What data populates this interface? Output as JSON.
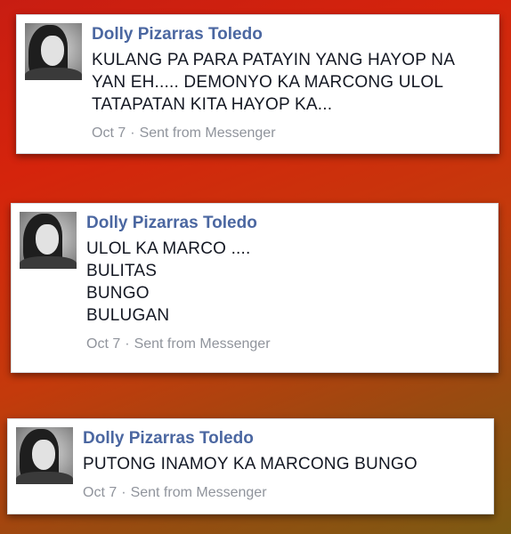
{
  "messages": [
    {
      "author": "Dolly Pizarras Toledo",
      "lines": [
        "KULANG PA PARA PATAYIN YANG HAYOP NA",
        "YAN EH..... DEMONYO KA MARCONG ULOL",
        "TATAPATAN KITA HAYOP KA..."
      ],
      "date": "Oct 7",
      "separator": "·",
      "source": "Sent from Messenger"
    },
    {
      "author": "Dolly Pizarras Toledo",
      "lines": [
        "ULOL KA MARCO ....",
        "BULITAS",
        "BUNGO",
        "BULUGAN"
      ],
      "date": "Oct 7",
      "separator": "·",
      "source": "Sent from Messenger"
    },
    {
      "author": "Dolly Pizarras Toledo",
      "lines": [
        "PUTONG INAMOY KA MARCONG BUNGO"
      ],
      "date": "Oct 7",
      "separator": "·",
      "source": "Sent from Messenger"
    }
  ],
  "colors": {
    "author": "#4b67a1",
    "text": "#141823",
    "meta": "#90949c"
  }
}
